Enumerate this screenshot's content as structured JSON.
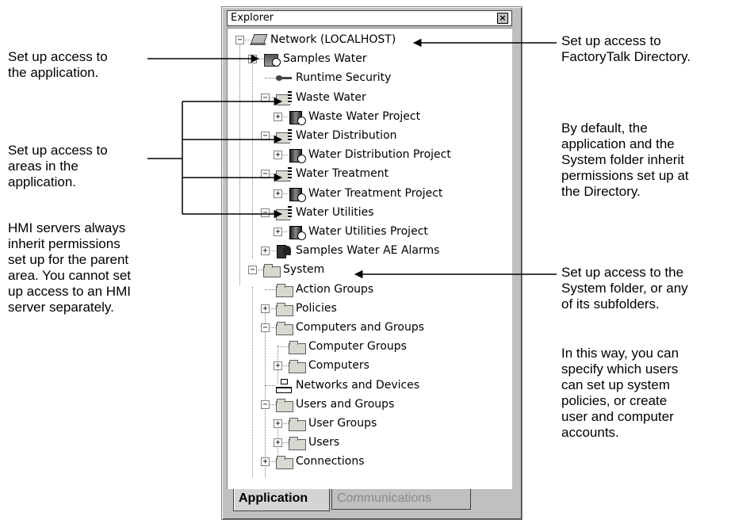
{
  "explorer": {
    "title": "Explorer",
    "close_glyph": "×",
    "tree": [
      {
        "label": "Network (LOCALHOST)",
        "icon": "network-icon",
        "expander": "minus"
      },
      {
        "label": "Samples Water",
        "icon": "application-icon",
        "expander": "minus"
      },
      {
        "label": "Runtime Security",
        "icon": "key-icon",
        "expander": ""
      },
      {
        "label": "Waste Water",
        "icon": "area-icon",
        "expander": "minus"
      },
      {
        "label": "Waste Water Project",
        "icon": "hmi-server-icon",
        "expander": "plus"
      },
      {
        "label": "Water Distribution",
        "icon": "area-icon",
        "expander": "minus"
      },
      {
        "label": "Water Distribution Project",
        "icon": "hmi-server-icon",
        "expander": "plus"
      },
      {
        "label": "Water Treatment",
        "icon": "area-icon",
        "expander": "minus"
      },
      {
        "label": "Water Treatment Project",
        "icon": "hmi-server-icon",
        "expander": "plus"
      },
      {
        "label": "Water Utilities",
        "icon": "area-icon",
        "expander": "minus"
      },
      {
        "label": "Water Utilities Project",
        "icon": "hmi-server-icon",
        "expander": "plus"
      },
      {
        "label": "Samples Water AE Alarms",
        "icon": "alarm-server-icon",
        "expander": "plus"
      },
      {
        "label": "System",
        "icon": "folder-icon",
        "expander": "minus"
      },
      {
        "label": "Action Groups",
        "icon": "folder-icon",
        "expander": ""
      },
      {
        "label": "Policies",
        "icon": "folder-icon",
        "expander": "plus"
      },
      {
        "label": "Computers and Groups",
        "icon": "folder-icon",
        "expander": "minus"
      },
      {
        "label": "Computer Groups",
        "icon": "folder-icon",
        "expander": ""
      },
      {
        "label": "Computers",
        "icon": "folder-icon",
        "expander": "plus"
      },
      {
        "label": "Networks and Devices",
        "icon": "network-devices-icon",
        "expander": ""
      },
      {
        "label": "Users and Groups",
        "icon": "folder-icon",
        "expander": "minus"
      },
      {
        "label": "User Groups",
        "icon": "folder-icon",
        "expander": "plus"
      },
      {
        "label": "Users",
        "icon": "folder-icon",
        "expander": "plus"
      },
      {
        "label": "Connections",
        "icon": "folder-icon",
        "expander": "plus"
      }
    ],
    "tabs": {
      "active": "Application",
      "inactive": "Communications"
    }
  },
  "callouts": {
    "left_application": "Set up access to\nthe application.",
    "left_areas": "Set up access to\nareas in the\napplication.",
    "left_hmi": "HMI servers always\ninherit permissions\nset up for the parent\narea. You cannot set\nup access to an HMI\nserver separately.",
    "right_directory": "Set up access to\nFactoryTalk Directory.",
    "right_default": "By default, the\napplication and the\nSystem folder inherit\npermissions set up at\nthe Directory.",
    "right_system": "Set up access to the\nSystem folder, or any\nof its subfolders.",
    "right_way": "In this way, you can\nspecify which users\ncan set up system\npolicies, or create\nuser and computer\naccounts."
  }
}
